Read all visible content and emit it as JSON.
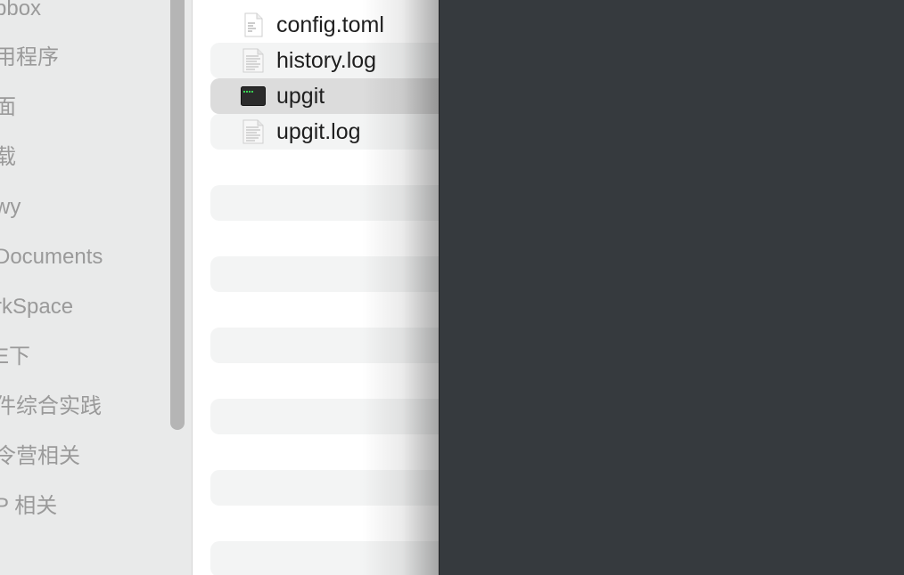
{
  "sidebar": {
    "items": [
      {
        "label": "pbox"
      },
      {
        "label": "用程序"
      },
      {
        "label": "面"
      },
      {
        "label": "载"
      },
      {
        "label": "wy"
      },
      {
        "label": "Documents"
      },
      {
        "label": "rkSpace"
      },
      {
        "label": "E下"
      },
      {
        "label": "件综合实践"
      },
      {
        "label": "令营相关"
      },
      {
        "label": "P 相关"
      }
    ]
  },
  "files": [
    {
      "name": "config.toml",
      "icon": "text-file-icon"
    },
    {
      "name": "history.log",
      "icon": "log-file-icon"
    },
    {
      "name": "upgit",
      "icon": "terminal-exec-icon",
      "selected": true
    },
    {
      "name": "upgit.log",
      "icon": "log-file-icon"
    }
  ],
  "colors": {
    "sidebar_bg": "#e9eaea",
    "selection": "#dcdcdc",
    "zebra": "#f3f4f4",
    "terminal_bg": "#363a3e"
  }
}
